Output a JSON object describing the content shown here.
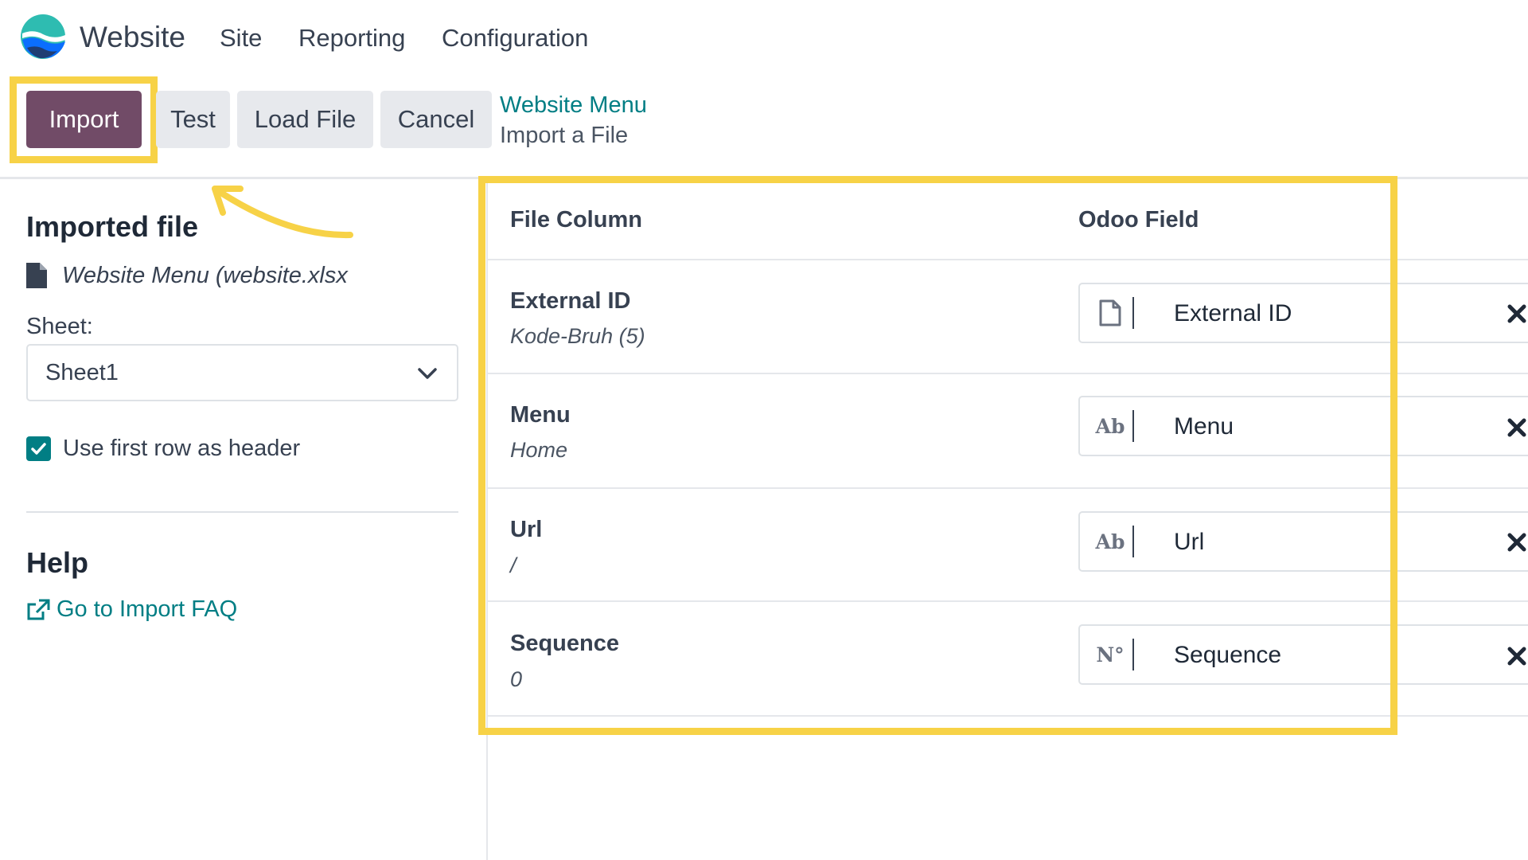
{
  "navbar": {
    "app_name": "Website",
    "menu": [
      "Site",
      "Reporting",
      "Configuration"
    ],
    "logo_colors": [
      "#2ebcb1",
      "#0b6efd",
      "#1f3d73"
    ]
  },
  "control_panel": {
    "buttons": {
      "import": "Import",
      "test": "Test",
      "load_file": "Load File",
      "cancel": "Cancel"
    },
    "breadcrumb": {
      "parent": "Website Menu",
      "current": "Import a File"
    },
    "highlight_color": "#f7d247"
  },
  "sidebar": {
    "imported_file_heading": "Imported file",
    "file_name": "Website Menu (website.xlsx",
    "sheet_label": "Sheet:",
    "sheet_value": "Sheet1",
    "header_checkbox": {
      "label": "Use first row as header",
      "checked": true
    },
    "help_heading": "Help",
    "faq_link": "Go to Import FAQ"
  },
  "mapping": {
    "headers": {
      "file_column": "File Column",
      "odoo_field": "Odoo Field"
    },
    "rows": [
      {
        "column": "External ID",
        "sample": "Kode-Bruh (5)",
        "type_icon": "file-icon",
        "field": "External ID"
      },
      {
        "column": "Menu",
        "sample": "Home",
        "type_icon": "Ab",
        "field": "Menu"
      },
      {
        "column": "Url",
        "sample": "/",
        "type_icon": "Ab",
        "field": "Url"
      },
      {
        "column": "Sequence",
        "sample": "0",
        "type_icon": "N°",
        "field": "Sequence"
      }
    ]
  },
  "colors": {
    "primary": "#714b67",
    "link": "#017e84",
    "secondary_button": "#e7e9ed"
  }
}
